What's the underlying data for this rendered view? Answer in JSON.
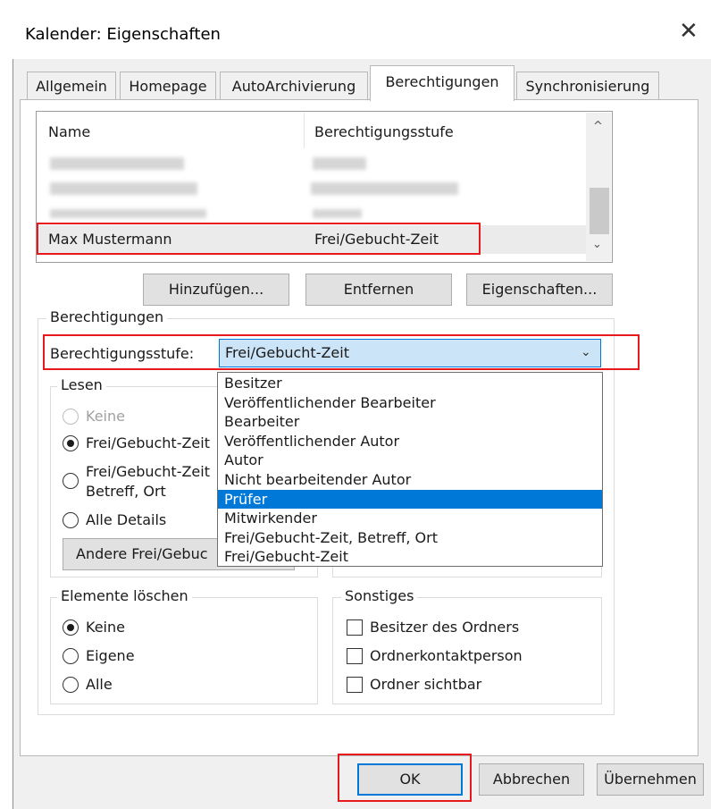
{
  "window": {
    "title": "Kalender: Eigenschaften",
    "close_glyph": "✕"
  },
  "tabs": [
    {
      "label": "Allgemein",
      "active": false
    },
    {
      "label": "Homepage",
      "active": false
    },
    {
      "label": "AutoArchivierung",
      "active": false
    },
    {
      "label": "Berechtigungen",
      "active": true
    },
    {
      "label": "Synchronisierung",
      "active": false
    }
  ],
  "list": {
    "headers": [
      "Name",
      "Berechtigungsstufe"
    ],
    "selected_row": {
      "name": "Max Mustermann",
      "level": "Frei/Gebucht-Zeit"
    },
    "scroll_up": "^",
    "scroll_down": "⌄"
  },
  "list_buttons": {
    "add": "Hinzufügen...",
    "remove": "Entfernen",
    "properties": "Eigenschaften..."
  },
  "permissions": {
    "group_label": "Berechtigungen",
    "level_label": "Berechtigungsstufe:",
    "level_value": "Frei/Gebucht-Zeit",
    "dropdown_chevron": "⌄",
    "options": [
      "Besitzer",
      "Veröffentlichender Bearbeiter",
      "Bearbeiter",
      "Veröffentlichender Autor",
      "Autor",
      "Nicht bearbeitender Autor",
      "Prüfer",
      "Mitwirkender",
      "Frei/Gebucht-Zeit, Betreff, Ort",
      "Frei/Gebucht-Zeit"
    ],
    "highlighted_option": "Prüfer"
  },
  "read_group": {
    "label": "Lesen",
    "options": [
      "Keine",
      "Frei/Gebucht-Zeit",
      "Frei/Gebucht-Zeit",
      "Betreff, Ort",
      "Alle Details"
    ],
    "selected": "Frei/Gebucht-Zeit",
    "other_button": "Andere Frei/Gebuc"
  },
  "delete_group": {
    "label": "Elemente löschen",
    "options": [
      "Keine",
      "Eigene",
      "Alle"
    ],
    "selected": "Keine"
  },
  "other_group": {
    "label": "Sonstiges",
    "checkboxes": [
      {
        "label": "Besitzer des Ordners",
        "checked": false
      },
      {
        "label": "Ordnerkontaktperson",
        "checked": false
      },
      {
        "label": "Ordner sichtbar",
        "checked": false
      }
    ]
  },
  "footer": {
    "ok": "OK",
    "cancel": "Abbrechen",
    "apply": "Übernehmen"
  },
  "colors": {
    "accent": "#0078d7",
    "highlight_red": "#e8191c",
    "combo_fill": "#cce4f7"
  }
}
